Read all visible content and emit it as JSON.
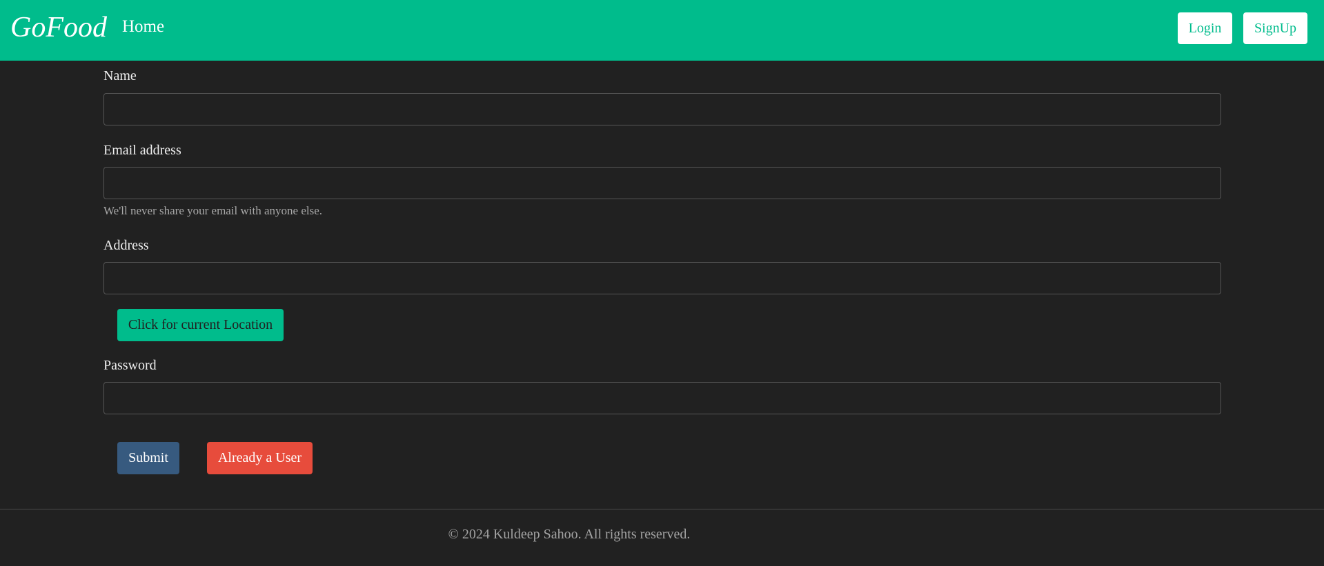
{
  "navbar": {
    "brand": "GoFood",
    "home_label": "Home",
    "login_label": "Login",
    "signup_label": "SignUp"
  },
  "form": {
    "name": {
      "label": "Name",
      "value": ""
    },
    "email": {
      "label": "Email address",
      "value": "",
      "help": "We'll never share your email with anyone else."
    },
    "address": {
      "label": "Address",
      "value": ""
    },
    "location_button": "Click for current Location",
    "password": {
      "label": "Password",
      "value": ""
    },
    "submit_label": "Submit",
    "already_user_label": "Already a User"
  },
  "footer": {
    "copyright": "© 2024 Kuldeep Sahoo. All rights reserved."
  },
  "colors": {
    "brand": "#00bc8c",
    "background": "#212121",
    "submit": "#375a7f",
    "danger": "#e74c3c"
  }
}
